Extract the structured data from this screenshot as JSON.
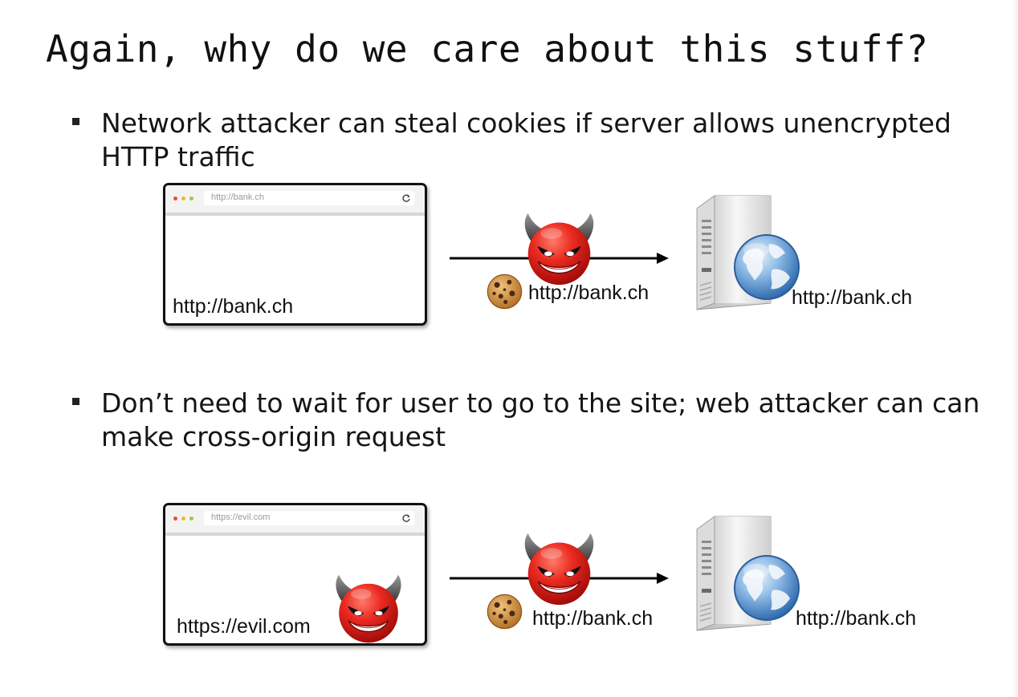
{
  "slide": {
    "title": "Again, why do we care about this stuff?"
  },
  "bullets": [
    {
      "text": "Network attacker can steal cookies if server allows unencrypted HTTP traffic"
    },
    {
      "text": "Don’t need to wait for user to go to the site; web attacker can can make cross-origin request"
    }
  ],
  "diagram1": {
    "browser_url": "http://bank.ch",
    "browser_label": "http://bank.ch",
    "request_label": "http://bank.ch",
    "server_label": "http://bank.ch"
  },
  "diagram2": {
    "browser_url": "https://evil.com",
    "browser_label": "https://evil.com",
    "request_label": "http://bank.ch",
    "server_label": "http://bank.ch"
  },
  "icons": {
    "attacker": "devil-icon",
    "cookie": "cookie-icon",
    "server": "web-server-icon",
    "globe": "globe-icon",
    "reload": "reload-icon"
  },
  "colors": {
    "devil_red": "#e8231e",
    "devil_horn": "#555555",
    "cookie": "#c98a3c",
    "globe_blue": "#3f7fc6",
    "arrow": "#000000"
  }
}
